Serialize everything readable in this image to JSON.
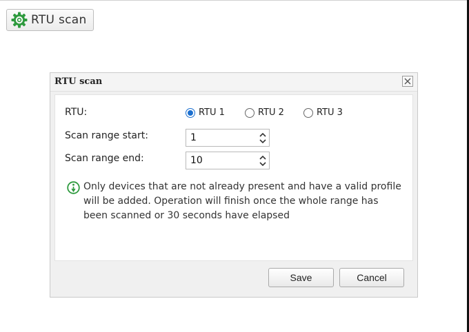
{
  "toolbar": {
    "rtu_scan_label": "RTU scan",
    "icon": "gear-icon"
  },
  "dialog": {
    "title": "RTU scan",
    "close_icon": "close-icon",
    "rtu": {
      "label": "RTU:",
      "options": [
        "RTU 1",
        "RTU 2",
        "RTU 3"
      ],
      "selected": "RTU 1"
    },
    "scan_start": {
      "label": "Scan range start:",
      "value": "1"
    },
    "scan_end": {
      "label": "Scan range end:",
      "value": "10"
    },
    "info": {
      "icon": "info-icon",
      "text": "Only devices that are not already present and have a valid profile will be added. Operation will finish once the whole range has been scanned or 30 seconds have elapsed"
    },
    "buttons": {
      "save": "Save",
      "cancel": "Cancel"
    }
  },
  "colors": {
    "accent": "#1b6fcf",
    "icon_green": "#2e9a3e"
  }
}
